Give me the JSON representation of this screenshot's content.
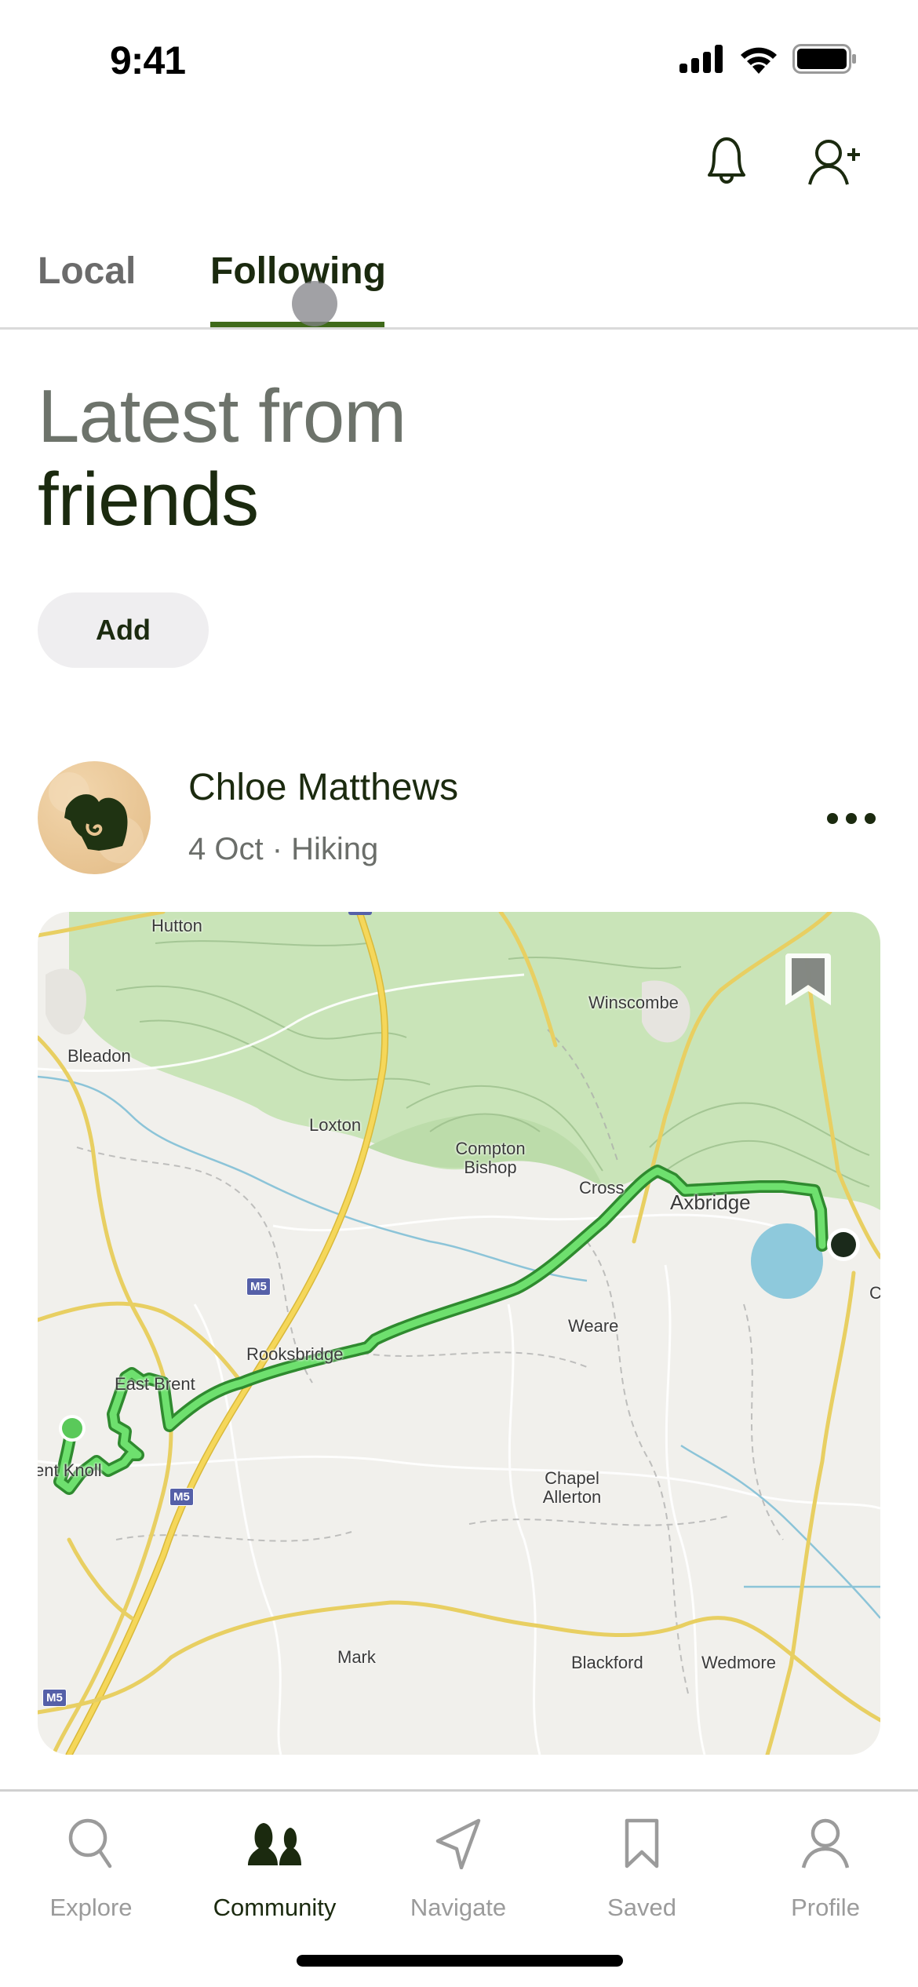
{
  "status_bar": {
    "time": "9:41"
  },
  "header": {
    "icons": [
      "bell-icon",
      "add-person-icon"
    ]
  },
  "tabs": [
    {
      "label": "Local",
      "active": false
    },
    {
      "label": "Following",
      "active": true
    }
  ],
  "feed": {
    "heading_line1": "Latest from",
    "heading_line2": "friends",
    "add_label": "Add"
  },
  "post": {
    "author": "Chloe Matthews",
    "meta": "4 Oct · Hiking",
    "activity": "Hiking",
    "date": "4 Oct",
    "map": {
      "labels": [
        "Hutton",
        "Winscombe",
        "Bleadon",
        "Loxton",
        "Compton Bishop",
        "Cross",
        "Axbridge",
        "Weare",
        "Rooksbridge",
        "East Brent",
        "Brent Knoll",
        "Chapel Allerton",
        "Mark",
        "Blackford",
        "Wedmore",
        "C"
      ],
      "road_shields": [
        "M5",
        "M5",
        "M5"
      ],
      "route_color": "#5ad45a",
      "start_marker_color": "#5ac95a",
      "end_marker_color": "#1b2a1b"
    }
  },
  "bottom_nav": [
    {
      "label": "Explore",
      "icon": "search-icon",
      "active": false
    },
    {
      "label": "Community",
      "icon": "community-icon",
      "active": true
    },
    {
      "label": "Navigate",
      "icon": "navigate-arrow-icon",
      "active": false
    },
    {
      "label": "Saved",
      "icon": "bookmark-icon",
      "active": false
    },
    {
      "label": "Profile",
      "icon": "profile-icon",
      "active": false
    }
  ],
  "colors": {
    "accent": "#3f6a1a",
    "text_dark": "#1b2a0f",
    "text_muted": "#6d736b",
    "inactive_nav": "#9b9b9b"
  }
}
